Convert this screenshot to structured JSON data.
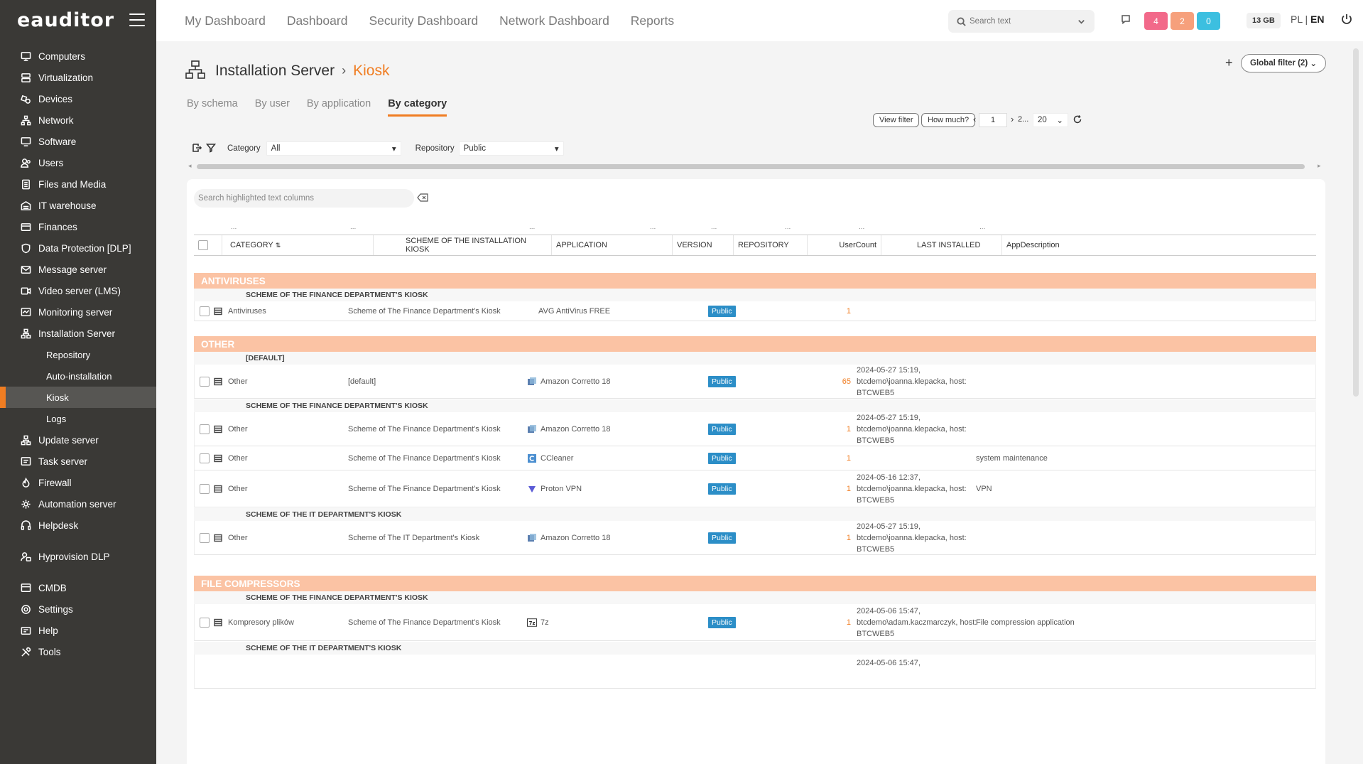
{
  "app": {
    "logo": "eauditor",
    "accent": "#f07d22"
  },
  "sidebar": {
    "items": [
      {
        "label": "Computers",
        "icon": "monitor-icon"
      },
      {
        "label": "Virtualization",
        "icon": "server-icon"
      },
      {
        "label": "Devices",
        "icon": "devices-icon"
      },
      {
        "label": "Network",
        "icon": "network-icon"
      },
      {
        "label": "Software",
        "icon": "software-icon"
      },
      {
        "label": "Users",
        "icon": "users-icon"
      },
      {
        "label": "Files and Media",
        "icon": "files-icon"
      },
      {
        "label": "IT warehouse",
        "icon": "warehouse-icon"
      },
      {
        "label": "Finances",
        "icon": "finances-icon"
      },
      {
        "label": "Data Protection [DLP]",
        "icon": "shield-icon"
      },
      {
        "label": "Message server",
        "icon": "mail-icon"
      },
      {
        "label": "Video server (LMS)",
        "icon": "video-icon"
      },
      {
        "label": "Monitoring server",
        "icon": "monitoring-icon"
      },
      {
        "label": "Installation Server",
        "icon": "installation-icon"
      }
    ],
    "subitems": [
      {
        "label": "Repository"
      },
      {
        "label": "Auto-installation"
      },
      {
        "label": "Kiosk"
      },
      {
        "label": "Logs"
      }
    ],
    "items2": [
      {
        "label": "Update server",
        "icon": "update-icon"
      },
      {
        "label": "Task server",
        "icon": "task-icon"
      },
      {
        "label": "Firewall",
        "icon": "firewall-icon"
      },
      {
        "label": "Automation server",
        "icon": "automation-icon"
      },
      {
        "label": "Helpdesk",
        "icon": "helpdesk-icon"
      }
    ],
    "items3": [
      {
        "label": "Hyprovision DLP",
        "icon": "hyprovision-icon"
      }
    ],
    "items4": [
      {
        "label": "CMDB",
        "icon": "cmdb-icon"
      },
      {
        "label": "Settings",
        "icon": "gear-icon"
      },
      {
        "label": "Help",
        "icon": "help-icon"
      },
      {
        "label": "Tools",
        "icon": "tools-icon"
      }
    ]
  },
  "topbar": {
    "links": [
      "My Dashboard",
      "Dashboard",
      "Security Dashboard",
      "Network Dashboard",
      "Reports"
    ],
    "search_placeholder": "Search text",
    "badges": [
      {
        "value": "4",
        "color": "#f2698a"
      },
      {
        "value": "2",
        "color": "#f6a07c"
      },
      {
        "value": "0",
        "color": "#3cbfe0"
      }
    ],
    "memory": "13 GB",
    "lang_pl": "PL",
    "lang_sep": "|",
    "lang_en": "EN"
  },
  "page": {
    "title": "Installation Server",
    "subtitle": "Kiosk",
    "global_filter": "Global filter (2)",
    "tabs": [
      "By schema",
      "By user",
      "By application",
      "By category"
    ],
    "active_tab": 3
  },
  "filters": {
    "category_label": "Category",
    "category_value": "All",
    "repository_label": "Repository",
    "repository_value": "Public",
    "view_filter": "View filter",
    "how_much": "How much?",
    "page": "1",
    "page_more": "2...",
    "page_size": "20"
  },
  "table": {
    "search_placeholder": "Search highlighted text columns",
    "dots": "...",
    "columns": [
      "CATEGORY",
      "SCHEME OF THE INSTALLATION KIOSK",
      "APPLICATION",
      "VERSION",
      "REPOSITORY",
      "UserCount",
      "LAST INSTALLED",
      "AppDescription"
    ],
    "groups": [
      {
        "name": "ANTIVIRUSES"
      },
      {
        "name": "OTHER"
      },
      {
        "name": "FILE COMPRESSORS"
      }
    ],
    "schemes": {
      "finance": "SCHEME OF THE FINANCE DEPARTMENT'S KIOSK",
      "default": "[DEFAULT]",
      "it": "SCHEME OF THE IT DEPARTMENT'S KIOSK"
    },
    "rows": [
      {
        "category": "Antiviruses",
        "scheme": "Scheme of The Finance Department's Kiosk",
        "app": "AVG AntiVirus FREE",
        "repo": "Public",
        "count": "1",
        "last1": "",
        "last2": "",
        "last3": "",
        "desc": ""
      },
      {
        "category": "Other",
        "scheme": "[default]",
        "app": "Amazon Corretto 18",
        "repo": "Public",
        "count": "65",
        "last1": "2024-05-27 15:19,",
        "last2": "btcdemo\\joanna.klepacka, host:",
        "last3": "BTCWEB5",
        "desc": ""
      },
      {
        "category": "Other",
        "scheme": "Scheme of The Finance Department's Kiosk",
        "app": "Amazon Corretto 18",
        "repo": "Public",
        "count": "1",
        "last1": "2024-05-27 15:19,",
        "last2": "btcdemo\\joanna.klepacka, host:",
        "last3": "BTCWEB5",
        "desc": ""
      },
      {
        "category": "Other",
        "scheme": "Scheme of The Finance Department's Kiosk",
        "app": "CCleaner",
        "repo": "Public",
        "count": "1",
        "last1": "",
        "last2": "",
        "last3": "",
        "desc": "system maintenance"
      },
      {
        "category": "Other",
        "scheme": "Scheme of The Finance Department's Kiosk",
        "app": "Proton VPN",
        "repo": "Public",
        "count": "1",
        "last1": "2024-05-16 12:37,",
        "last2": "btcdemo\\joanna.klepacka, host:",
        "last3": "BTCWEB5",
        "desc": "VPN"
      },
      {
        "category": "Other",
        "scheme": "Scheme of The IT Department's Kiosk",
        "app": "Amazon Corretto 18",
        "repo": "Public",
        "count": "1",
        "last1": "2024-05-27 15:19,",
        "last2": "btcdemo\\joanna.klepacka, host:",
        "last3": "BTCWEB5",
        "desc": ""
      },
      {
        "category": "Kompresory plików",
        "scheme": "Scheme of The Finance Department's Kiosk",
        "app": "7z",
        "repo": "Public",
        "count": "1",
        "last1": "2024-05-06 15:47,",
        "last2": "btcdemo\\adam.kaczmarczyk, host:",
        "last3": "BTCWEB5",
        "desc": "File compression application"
      },
      {
        "last1": "2024-05-06 15:47,"
      }
    ]
  }
}
